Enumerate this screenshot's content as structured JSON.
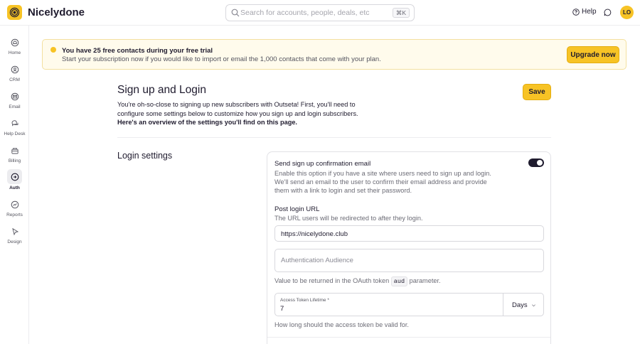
{
  "app": {
    "brand": "Nicelydone"
  },
  "search": {
    "placeholder": "Search for accounts, people, deals, etc",
    "shortcut": "⌘K"
  },
  "header": {
    "help_label": "Help",
    "avatar_initials": "LO"
  },
  "sidebar": {
    "items": [
      {
        "label": "Home",
        "icon": "home-icon"
      },
      {
        "label": "CRM",
        "icon": "crm-icon"
      },
      {
        "label": "Email",
        "icon": "email-icon"
      },
      {
        "label": "Help Desk",
        "icon": "help-desk-icon"
      },
      {
        "label": "Billing",
        "icon": "billing-icon"
      },
      {
        "label": "Auth",
        "icon": "auth-icon",
        "active": true
      },
      {
        "label": "Reports",
        "icon": "reports-icon"
      },
      {
        "label": "Design",
        "icon": "design-icon"
      }
    ]
  },
  "banner": {
    "title": "You have 25 free contacts during your free trial",
    "subtitle": "Start your subscription now if you would like to import or email the 1,000 contacts that come with your plan.",
    "button": "Upgrade now"
  },
  "page": {
    "title": "Sign up and Login",
    "intro_plain": "You're oh-so-close to signing up new subscribers with Outseta! First, you'll need to configure some settings below to customize how you sign up and login subscribers.",
    "intro_bold": "Here's an overview of the settings you'll find on this page.",
    "save_label": "Save"
  },
  "login_settings": {
    "section_title": "Login settings",
    "confirmation": {
      "label": "Send sign up confirmation email",
      "description": "Enable this option if you have a site where users need to sign up and login. We'll send an email to the user to confirm their email address and provide them with a link to login and set their password.",
      "enabled": true
    },
    "post_login_url": {
      "label": "Post login URL",
      "description": "The URL users will be redirected to after they login.",
      "value": "https://nicelydone.club"
    },
    "auth_audience": {
      "placeholder": "Authentication Audience",
      "help_before": "Value to be returned in the OAuth token",
      "help_code": "aud",
      "help_after": "parameter."
    },
    "access_token": {
      "label": "Access Token Lifetime *",
      "value": "7",
      "unit": "Days",
      "help": "How long should the access token be valid for."
    }
  },
  "colors": {
    "accent": "#f7c325",
    "text": "#1f1b2e",
    "banner_bg": "#fffbec"
  }
}
